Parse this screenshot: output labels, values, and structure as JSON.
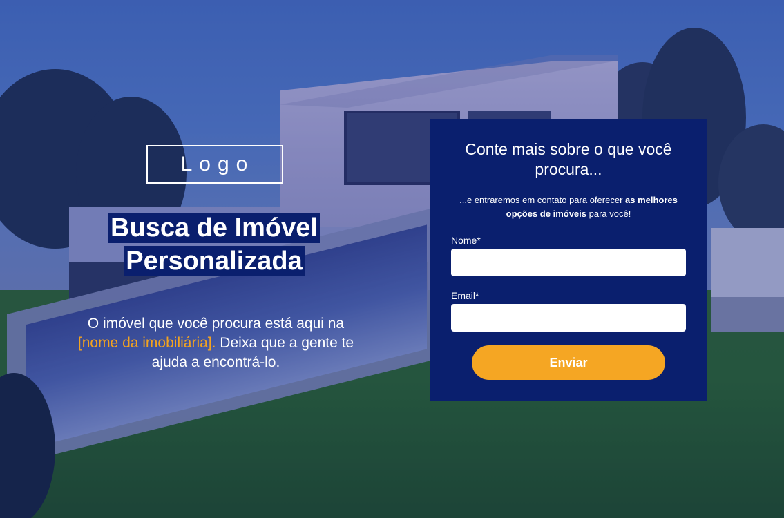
{
  "hero": {
    "logo_text": "Logo",
    "headline_line1": "Busca de Imóvel",
    "headline_line2": "Personalizada",
    "subtext_before": "O imóvel que você procura está aqui na ",
    "subtext_accent": "[nome da imobiliária].",
    "subtext_after": " Deixa que a gente te ajuda a encontrá-lo."
  },
  "form": {
    "title": "Conte mais sobre o que você procura...",
    "sub_before": "...e entraremos em contato para oferecer ",
    "sub_bold": "as melhores opções de imóveis",
    "sub_after": " para você!",
    "name_label": "Nome*",
    "name_value": "",
    "email_label": "Email*",
    "email_value": "",
    "submit_label": "Enviar"
  },
  "colors": {
    "brand_navy": "#0a1f6e",
    "accent_orange": "#f5a623",
    "accent_text": "#f2a321",
    "text_white": "#ffffff"
  }
}
